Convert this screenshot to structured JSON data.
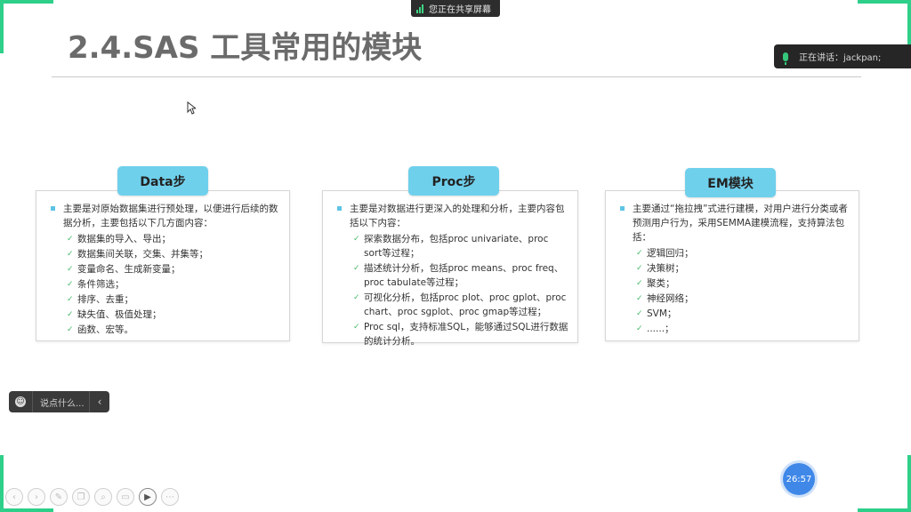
{
  "slide": {
    "title": "2.4.SAS 工具常用的模块"
  },
  "meeting": {
    "share_banner": "您正在共享屏幕",
    "speaking_label": "正在讲话：jackpan;",
    "chat_placeholder": "说点什么...",
    "chat_toggle": "‹",
    "timer": "26:57"
  },
  "cards": [
    {
      "title": "Data步",
      "main": "主要是对原始数据集进行预处理，以便进行后续的数据分析，主要包括以下几方面内容：",
      "items": [
        "数据集的导入、导出；",
        "数据集间关联，交集、并集等；",
        "变量命名、生成新变量；",
        "条件筛选；",
        "排序、去重；",
        "缺失值、极值处理；",
        "函数、宏等。"
      ]
    },
    {
      "title": "Proc步",
      "main": "主要是对数据进行更深入的处理和分析，主要内容包括以下内容：",
      "items": [
        "探索数据分布，包括proc univariate、proc sort等过程；",
        "描述统计分析，包括proc means、proc freq、proc tabulate等过程；",
        "可视化分析，包括proc plot、proc gplot、proc chart、proc sgplot、proc gmap等过程；",
        "Proc sql，支持标准SQL，能够通过SQL进行数据的统计分析。"
      ]
    },
    {
      "title": "EM模块",
      "main": "主要通过“拖拉拽”式进行建模，对用户进行分类或者预测用户行为，采用SEMMA建模流程，支持算法包括：",
      "items": [
        "逻辑回归；",
        "决策树；",
        "聚类；",
        "神经网络；",
        "SVM；",
        "......；"
      ]
    }
  ],
  "toolbar_icons": [
    "prev-icon",
    "next-icon",
    "pen-icon",
    "copy-icon",
    "zoom-icon",
    "screen-icon",
    "video-icon",
    "more-icon"
  ],
  "colors": {
    "accent_green": "#2fcf8a",
    "tag_blue": "#6fd0ec",
    "timer_blue": "#3f88e8"
  }
}
